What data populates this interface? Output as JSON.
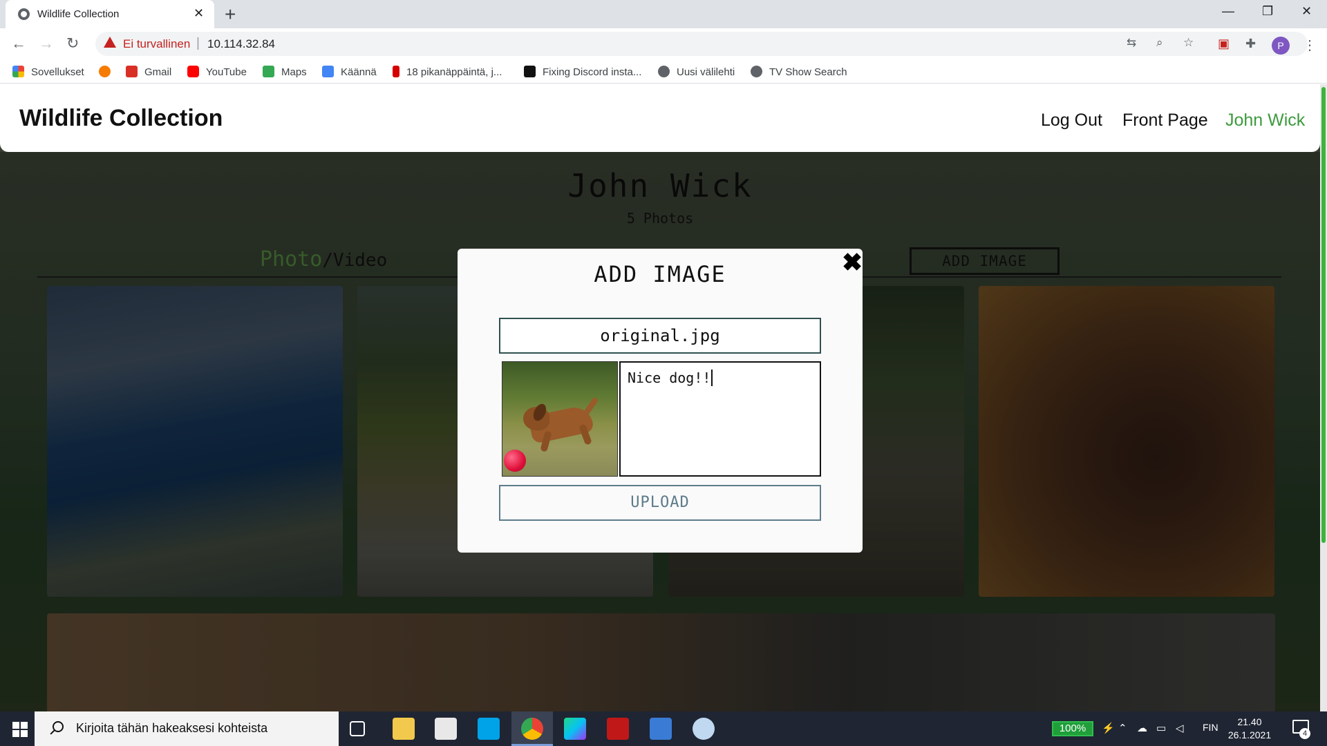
{
  "browser": {
    "tab_title": "Wildlife Collection",
    "tab_close": "✕",
    "new_tab": "+",
    "security_label": "Ei turvallinen",
    "url": "10.114.32.84",
    "profile_initial": "P",
    "window_controls": {
      "minimize": "—",
      "maximize": "❐",
      "close": "✕"
    },
    "bookmarks": [
      {
        "label": "Sovellukset",
        "icon": "apps-grid-icon",
        "color": "#ea4335"
      },
      {
        "label": "",
        "icon": "ubuntu-icon",
        "color": "#f57c00"
      },
      {
        "label": "Gmail",
        "icon": "gmail-icon",
        "color": "#d93025"
      },
      {
        "label": "YouTube",
        "icon": "youtube-icon",
        "color": "#ff0000"
      },
      {
        "label": "Maps",
        "icon": "maps-icon",
        "color": "#34a853"
      },
      {
        "label": "Käännä",
        "icon": "translate-icon",
        "color": "#4285f4"
      },
      {
        "label": "18 pikanäppäintä, j...",
        "icon": "il-icon",
        "color": "#d50000"
      },
      {
        "label": "Fixing Discord insta...",
        "icon": "a-icon",
        "color": "#111111"
      },
      {
        "label": "Uusi välilehti",
        "icon": "globe-icon",
        "color": "#5f6368"
      },
      {
        "label": "TV Show Search",
        "icon": "globe-icon",
        "color": "#5f6368"
      }
    ]
  },
  "site": {
    "title": "Wildlife Collection",
    "nav": {
      "logout": "Log Out",
      "front_page": "Front Page",
      "user": "John Wick"
    },
    "accent_color": "#3d9a3d"
  },
  "profile": {
    "name": "John Wick",
    "photo_count": "5 Photos",
    "toggle_photo": "Photo",
    "toggle_sep": "/",
    "toggle_video": "Video",
    "add_image_label": "ADD IMAGE"
  },
  "modal": {
    "title": "ADD IMAGE",
    "close": "✖",
    "file_name": "original.jpg",
    "caption": "Nice dog!!",
    "upload_label": "UPLOAD"
  },
  "taskbar": {
    "search_placeholder": "Kirjoita tähän hakeaksesi kohteista",
    "battery": "100%",
    "language": "FIN",
    "time": "21.40",
    "date": "26.1.2021",
    "notifications": "4"
  }
}
